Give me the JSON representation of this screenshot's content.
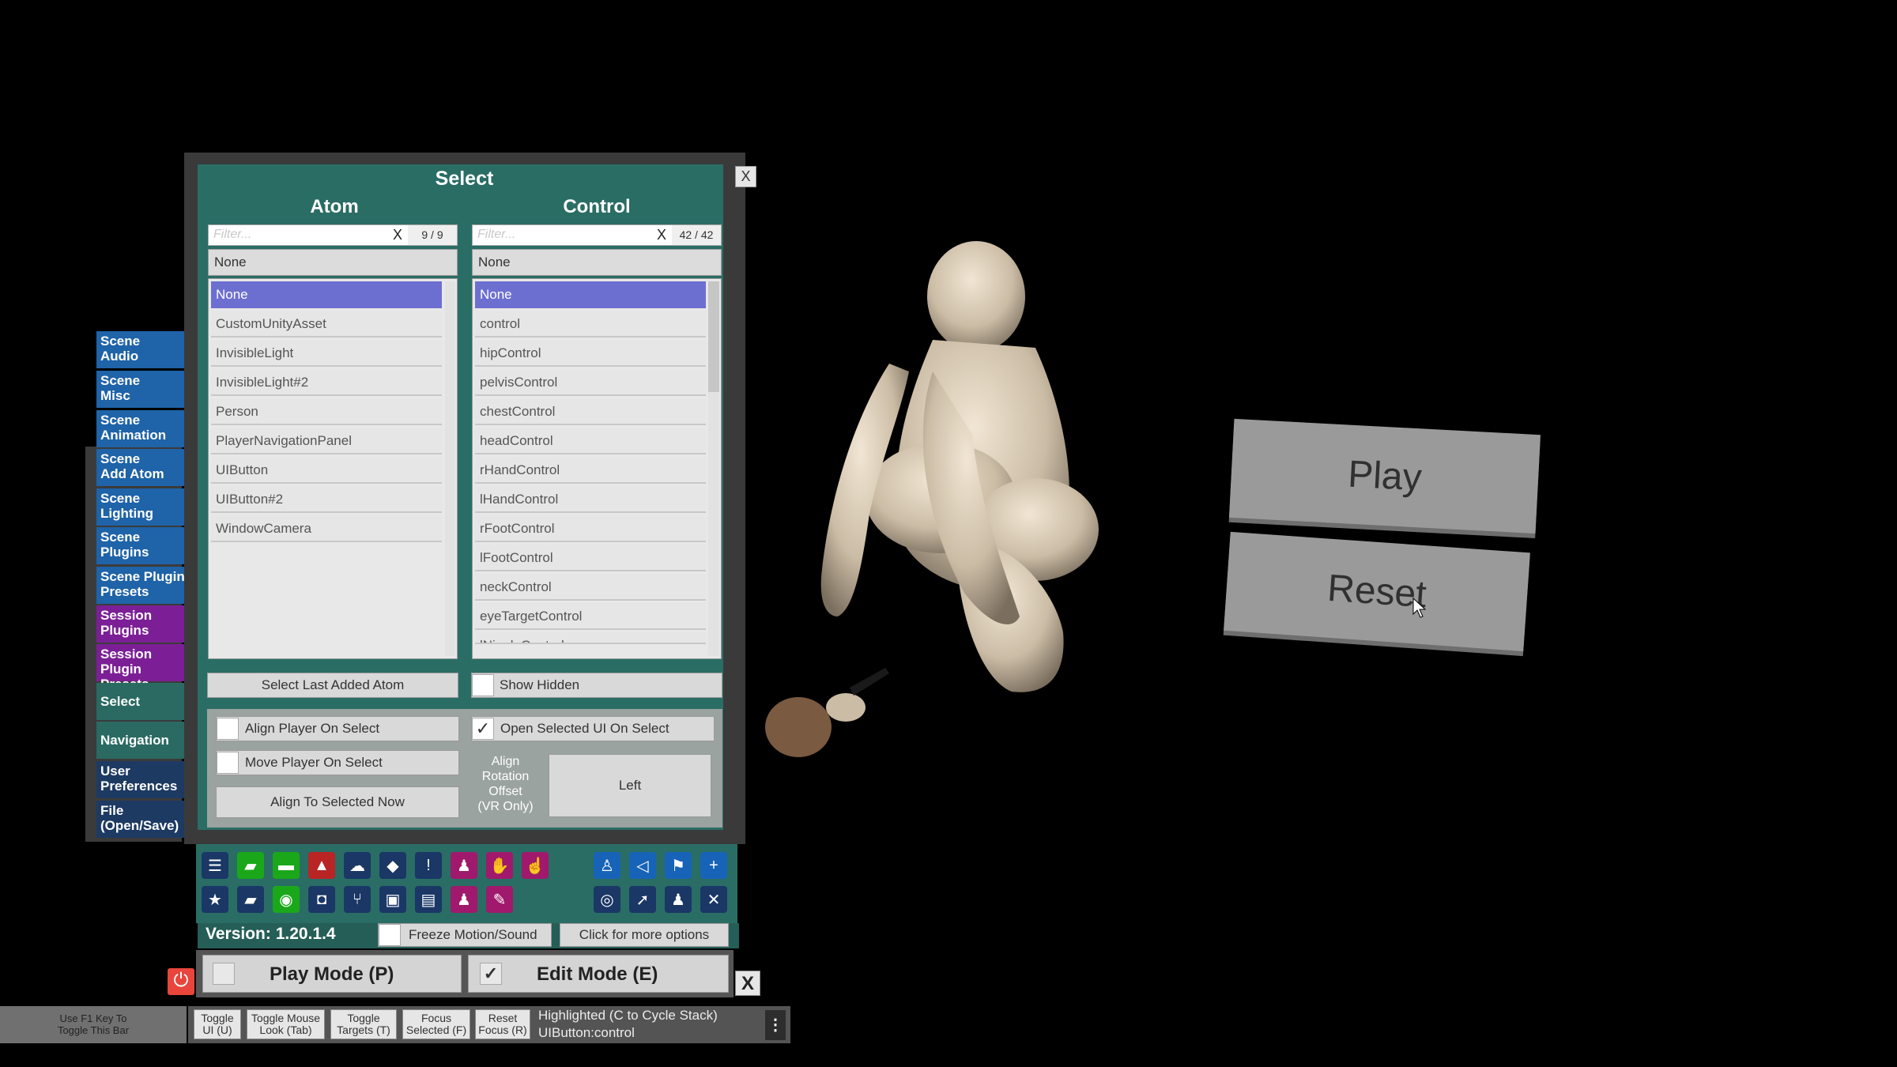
{
  "categories": [
    {
      "label": "Scene\nAudio",
      "color": "blue"
    },
    {
      "label": "Scene\nMisc",
      "color": "blue"
    },
    {
      "label": "Scene\nAnimation",
      "color": "blue"
    },
    {
      "label": "Scene\nAdd Atom",
      "color": "blue"
    },
    {
      "label": "Scene\nLighting",
      "color": "blue"
    },
    {
      "label": "Scene\nPlugins",
      "color": "blue"
    },
    {
      "label": "Scene Plugin\nPresets",
      "color": "blue"
    },
    {
      "label": "Session\nPlugins",
      "color": "purple"
    },
    {
      "label": "Session Plugin\nPresets",
      "color": "purple"
    },
    {
      "label": "Select",
      "color": "teal"
    },
    {
      "label": "Navigation",
      "color": "teal"
    },
    {
      "label": "User\nPreferences",
      "color": "navy"
    },
    {
      "label": "File\n(Open/Save)",
      "color": "navy"
    }
  ],
  "window": {
    "title": "Select",
    "close": "X",
    "atom": {
      "title": "Atom",
      "filter_placeholder": "Filter...",
      "clear": "X",
      "count": "9 / 9",
      "selected": "None",
      "items": [
        "None",
        "CustomUnityAsset",
        "InvisibleLight",
        "InvisibleLight#2",
        "Person",
        "PlayerNavigationPanel",
        "UIButton",
        "UIButton#2",
        "WindowCamera"
      ]
    },
    "control": {
      "title": "Control",
      "filter_placeholder": "Filter...",
      "clear": "X",
      "count": "42 / 42",
      "selected": "None",
      "items": [
        "None",
        "control",
        "hipControl",
        "pelvisControl",
        "chestControl",
        "headControl",
        "rHandControl",
        "lHandControl",
        "rFootControl",
        "lFootControl",
        "neckControl",
        "eyeTargetControl",
        "lNippleControl"
      ]
    },
    "select_last_added": "Select Last Added Atom",
    "show_hidden": "Show Hidden",
    "align_player": "Align Player On Select",
    "open_selected_ui": "Open Selected UI On Select",
    "move_player": "Move Player On Select",
    "align_to_selected": "Align To Selected Now",
    "align_rotation_label": "Align\nRotation\nOffset\n(VR Only)",
    "align_rotation_value": "Left"
  },
  "toolbar": {
    "row1": [
      {
        "icon": "menu-icon",
        "color": "navy",
        "glyph": "☰"
      },
      {
        "icon": "open-scene-icon",
        "color": "green",
        "glyph": "▰"
      },
      {
        "icon": "folder-icon",
        "color": "green",
        "glyph": "▬"
      },
      {
        "icon": "delete-icon",
        "color": "red",
        "glyph": "▲"
      },
      {
        "icon": "cloud-icon",
        "color": "navy",
        "glyph": "☁"
      },
      {
        "icon": "cube-icon",
        "color": "navy",
        "glyph": "◆"
      },
      {
        "icon": "alert-icon",
        "color": "navy",
        "glyph": "!"
      },
      {
        "icon": "person-settings-icon",
        "color": "magenta",
        "glyph": "♟"
      },
      {
        "icon": "hand-icon",
        "color": "magenta",
        "glyph": "✋"
      },
      {
        "icon": "pointer-hand-icon",
        "color": "magenta",
        "glyph": "☝"
      }
    ],
    "row2": [
      {
        "icon": "star-icon",
        "color": "navy",
        "glyph": "★"
      },
      {
        "icon": "open-folder-icon",
        "color": "navy",
        "glyph": "▰"
      },
      {
        "icon": "screenshot-icon",
        "color": "green",
        "glyph": "◉"
      },
      {
        "icon": "camera-icon",
        "color": "navy",
        "glyph": "◘"
      },
      {
        "icon": "hierarchy-icon",
        "color": "navy",
        "glyph": "⑂"
      },
      {
        "icon": "package-icon",
        "color": "navy",
        "glyph": "▣"
      },
      {
        "icon": "document-icon",
        "color": "navy",
        "glyph": "▤"
      },
      {
        "icon": "person-gear-icon",
        "color": "magenta",
        "glyph": "♟"
      },
      {
        "icon": "wrench-icon",
        "color": "magenta",
        "glyph": "✎"
      }
    ],
    "right_row1": [
      {
        "icon": "person-icon",
        "color": "blue",
        "glyph": "♙"
      },
      {
        "icon": "unity-icon",
        "color": "blue",
        "glyph": "◁"
      },
      {
        "icon": "flag-icon",
        "color": "blue",
        "glyph": "⚑"
      },
      {
        "icon": "plus-icon",
        "color": "blue",
        "glyph": "+"
      }
    ],
    "right_row2": [
      {
        "icon": "target-icon",
        "color": "navy",
        "glyph": "◎"
      },
      {
        "icon": "cursor-icon",
        "color": "navy",
        "glyph": "➚"
      },
      {
        "icon": "people-icon",
        "color": "navy",
        "glyph": "♟"
      },
      {
        "icon": "tools-icon",
        "color": "navy",
        "glyph": "✕"
      }
    ]
  },
  "version": "Version: 1.20.1.4",
  "freeze_motion": "Freeze Motion/Sound",
  "more_options": "Click for more options",
  "play_mode": "Play Mode (P)",
  "edit_mode": "Edit Mode (E)",
  "mode_close": "X",
  "bottom_bar": {
    "hint": "Use F1 Key To\nToggle This Bar",
    "buttons": [
      "Toggle\nUI (U)",
      "Toggle Mouse\nLook (Tab)",
      "Toggle\nTargets (T)",
      "Focus\nSelected (F)",
      "Reset\nFocus (R)"
    ],
    "highlighted": "Highlighted (C to Cycle Stack)",
    "highlighted_value": "UIButton:control"
  },
  "scene": {
    "play": "Play",
    "reset": "Reset"
  },
  "colors": {
    "panel": "#2a6d65",
    "selected_item": "#6d6fd0",
    "tab_blue": "#1f63a8",
    "tab_purple": "#7c1f96",
    "power": "#e8453c"
  }
}
